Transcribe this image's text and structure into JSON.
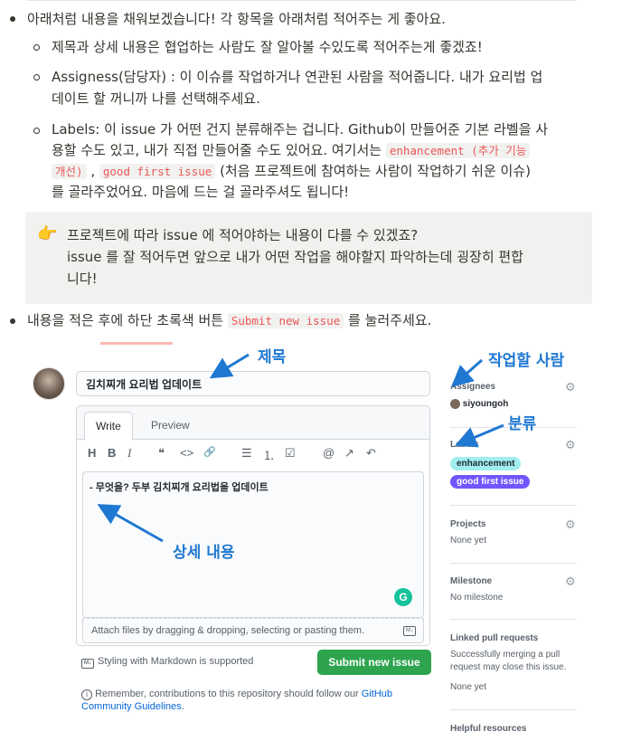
{
  "item1": {
    "text": "아래처럼 내용을 채워보겠습니다! 각 항목을 아래처럼 적어주는 게 좋아요."
  },
  "sub_items": {
    "title": "제목과 상세 내용은 협업하는 사람도 잘 알아볼 수있도록 적어주는게 좋겠죠!",
    "assignees_line1": "Assigness(담당자) : 이 이슈를 작업하거나 연관된 사람을 적어줍니다. 내가 요리법 업",
    "assignees_line2": "데이트 할 꺼니까 나를 선택해주세요.",
    "labels_line1": "Labels: 이 issue 가 어떤 건지 분류해주는 겁니다. Github이 만들어준 기본 라벨을 사",
    "labels_line2": "용할 수도 있고, 내가 직접 만들어줄 수도 있어요. 여기서는",
    "code_enhancement_a": "enhancement (추가 기능",
    "code_enhancement_b": "개선)",
    "comma": ",",
    "code_good_first": "good first issue",
    "labels_line3_rest": "(처음 프로젝트에 참여하는 사람이 작업하기 쉬운 이슈)",
    "labels_line4": "를 골라주었어요. 마음에 드는 걸 골라주셔도 됩니다!"
  },
  "callout": {
    "emoji": "👉",
    "line1": "프로젝트에 따라 issue 에 적어야하는 내용이 다를 수 있겠죠?",
    "line2": "issue 를 잘 적어두면 앞으로 내가 어떤 작업을 해야할지 파악하는데 굉장히 편합",
    "line3": "니다!"
  },
  "item2": {
    "before": "내용을 적은 후에 하단 초록색 버튼",
    "code": "Submit new issue",
    "after": "를 눌러주세요."
  },
  "github": {
    "title_value": "김치찌개 요리법 업데이트",
    "tab_write": "Write",
    "tab_preview": "Preview",
    "toolbar": [
      "H",
      "B",
      "I",
      "❝",
      "<>",
      "🔗",
      "☰",
      "⒈",
      "☑",
      "@",
      "↗",
      "↶"
    ],
    "body_value": "- 무엇을? 두부 김치찌개 요리법을 업데이트",
    "grammarly": "G",
    "attach_text": "Attach files by dragging & dropping, selecting or pasting them.",
    "md_badge": "M↓",
    "markdown_support": "Styling with Markdown is supported",
    "submit_label": "Submit new issue",
    "remember_text": "Remember, contributions to this repository should follow our",
    "remember_link_a": "GitHub",
    "remember_link_b": "Community Guidelines",
    "remember_period": ".",
    "sidebar": {
      "assignees_header": "Assignees",
      "assignee_name": "siyoungoh",
      "labels_header": "Labels",
      "label_enhancement": "enhancement",
      "label_enhancement_bg": "#a2eeef",
      "label_good_first": "good first issue",
      "label_good_first_bg": "#7057ff",
      "projects_header": "Projects",
      "projects_value": "None yet",
      "milestone_header": "Milestone",
      "milestone_value": "No milestone",
      "linked_header": "Linked pull requests",
      "linked_desc1": "Successfully merging a pull",
      "linked_desc2": "request may close this issue.",
      "linked_value": "None yet",
      "helpful_header": "Helpful resources"
    },
    "annotations": {
      "title": "제목",
      "assignee": "작업할 사람",
      "labels": "분류",
      "body": "상세 내용"
    }
  }
}
